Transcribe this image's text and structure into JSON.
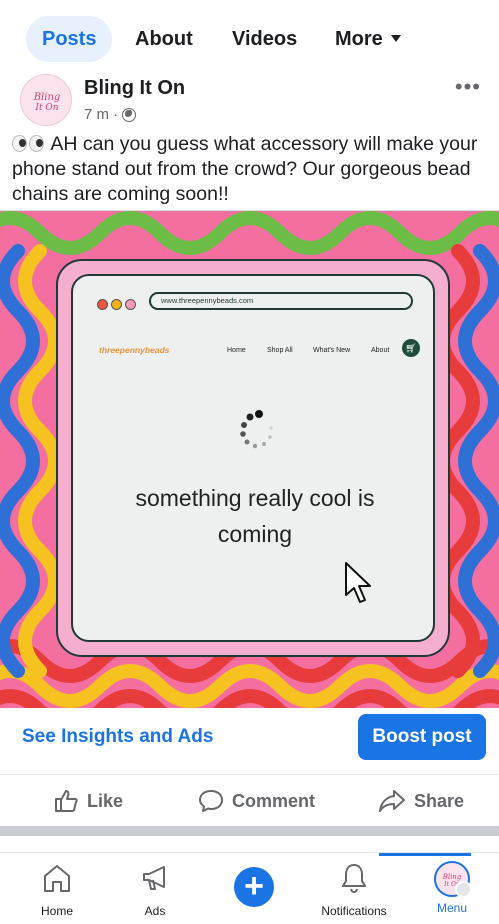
{
  "tabs": [
    {
      "label": "Posts",
      "active": true
    },
    {
      "label": "About"
    },
    {
      "label": "Videos"
    },
    {
      "label": "More"
    }
  ],
  "post": {
    "page_name": "Bling It On",
    "time": "7 m ·",
    "text": "AH can you guess what accessory will make your phone stand out from the crowd? Our gorgeous bead chains are coming soon!!",
    "avatar_text": "Bling It On"
  },
  "image": {
    "url": "www.threepennybeads.com",
    "logo": "threepennybeads",
    "nav": [
      "Home",
      "Shop All",
      "What's New",
      "About"
    ],
    "headline_line1": "something really cool is",
    "headline_line2": "coming"
  },
  "actions": {
    "insights": "See Insights and Ads",
    "boost": "Boost post",
    "like": "Like",
    "comment": "Comment",
    "share": "Share"
  },
  "bottom_nav": [
    {
      "label": "Home",
      "icon": "home-icon"
    },
    {
      "label": "Ads",
      "icon": "megaphone-icon"
    },
    {
      "label": "",
      "icon": "plus-icon"
    },
    {
      "label": "Notifications",
      "icon": "bell-icon"
    },
    {
      "label": "Menu",
      "icon": "avatar",
      "active": true
    }
  ],
  "colors": {
    "accent": "#1b74e4",
    "tab_active_bg": "#e7f0fd",
    "image_bg": "#f46fa0"
  }
}
